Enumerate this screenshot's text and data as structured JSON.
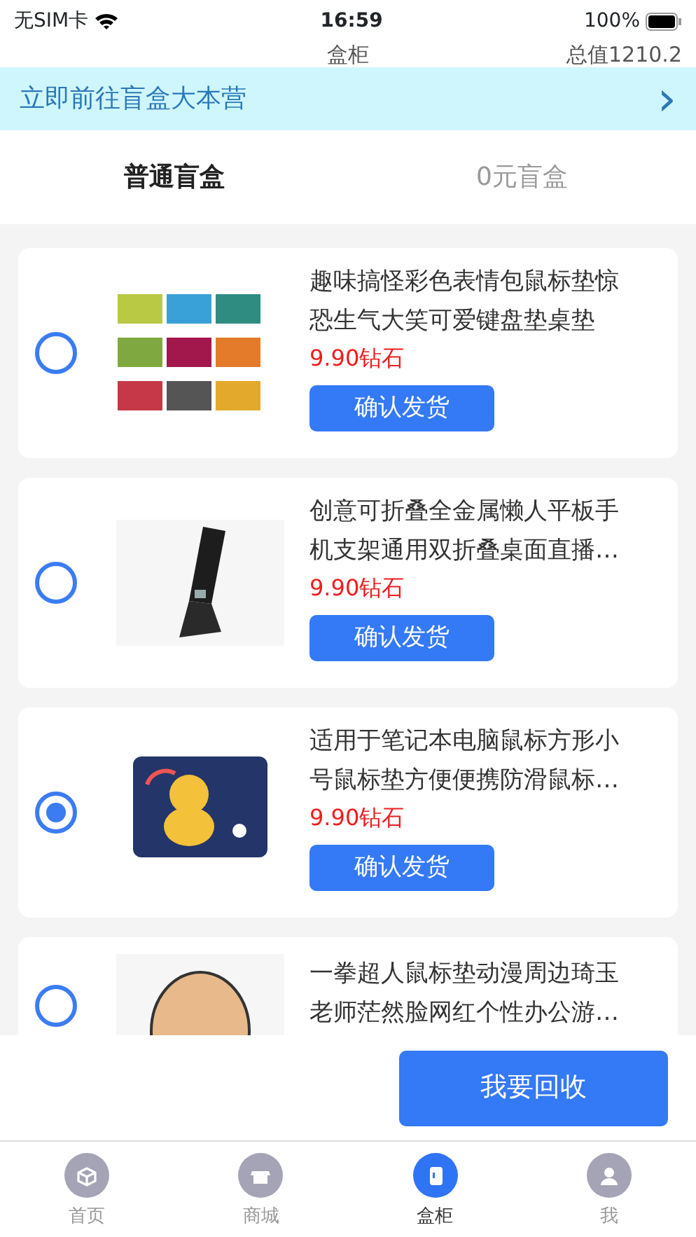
{
  "status_bar": {
    "carrier": "无SIM卡",
    "time": "16:59",
    "battery": "100%"
  },
  "header": {
    "title": "盒柜",
    "total": "总值1210.2"
  },
  "banner": {
    "text": "立即前往盲盒大本营",
    "arrow": "›"
  },
  "tabs": [
    {
      "label": "普通盲盒",
      "selected": true
    },
    {
      "label": "0元盲盒",
      "selected": false
    }
  ],
  "items": [
    {
      "title": "趣味搞怪彩色表情包鼠标垫惊恐生气大笑可爱键盘垫桌垫",
      "price": "9.90钻石",
      "button": "确认发货",
      "selected": false
    },
    {
      "title": "创意可折叠全金属懒人平板手机支架通用双折叠桌面直播…",
      "price": "9.90钻石",
      "button": "确认发货",
      "selected": false
    },
    {
      "title": "适用于笔记本电脑鼠标方形小号鼠标垫方便便携防滑鼠标…",
      "price": "9.90钻石",
      "button": "确认发货",
      "selected": true
    },
    {
      "title": "一拳超人鼠标垫动漫周边琦玉老师茫然脸网红个性办公游…",
      "selected": false
    }
  ],
  "action": {
    "label": "我要回收"
  },
  "nav": [
    {
      "label": "首页",
      "selected": false
    },
    {
      "label": "商城",
      "selected": false
    },
    {
      "label": "盒柜",
      "selected": true
    },
    {
      "label": "我",
      "selected": false
    }
  ]
}
